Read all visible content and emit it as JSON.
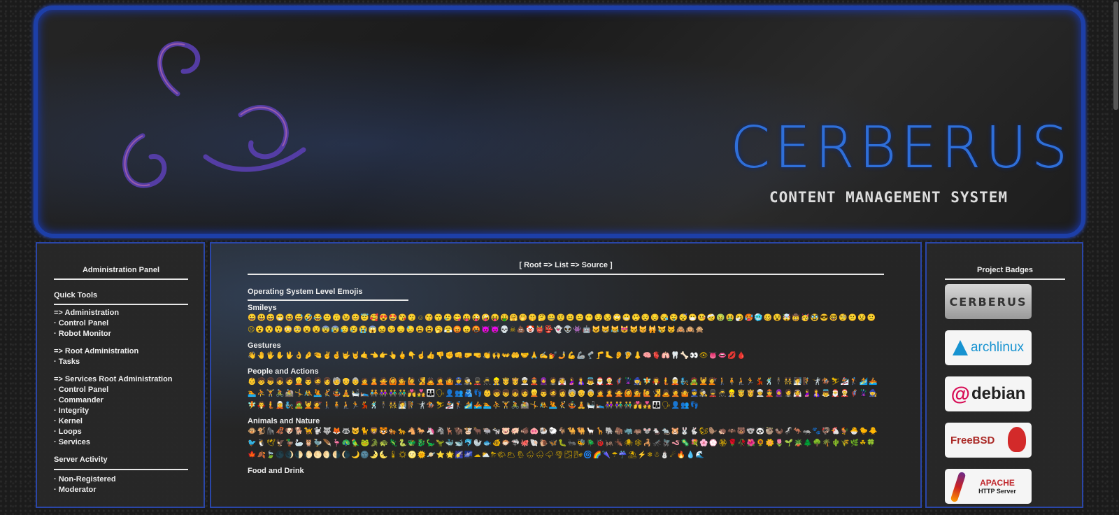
{
  "banner": {
    "title": "CERBERUS",
    "subtitle": "CONTENT MANAGEMENT SYSTEM",
    "colors": {
      "border": "#1d3fa8",
      "title": "#2f6fd8"
    }
  },
  "left_panel": {
    "title": "Administration Panel",
    "quick_tools": "Quick Tools",
    "groups": [
      {
        "header": "=> Administration",
        "items": [
          "· Control Panel",
          "· Robot Monitor"
        ]
      },
      {
        "header": "=> Root Administration",
        "items": [
          "· Tasks"
        ]
      },
      {
        "header": "=> Services Root Administration",
        "items": [
          "· Control Panel",
          "· Commander",
          "· Integrity",
          "· Kernel",
          "· Loops",
          "· Services"
        ]
      }
    ],
    "server_activity": "Server Activity",
    "activity_items": [
      "· Non-Registered",
      "· Moderator"
    ]
  },
  "main": {
    "breadcrumb": {
      "open": "[",
      "items": [
        "Root",
        "List",
        "Source"
      ],
      "sep": "=>",
      "close": "]"
    },
    "section_title": "Operating System Level Emojis",
    "categories": [
      {
        "name": "Smileys",
        "emojis": "😀😃😄😁😆😅🤣😂🙂🙃😉😊😇🥰😍🤩😘😗☺😚😙🥲😋😛😜🤪😝🤑🤗🤭🤫🤔🤐🤨😐😑😶😏😒🙄😬🤥😌😔😪🤤😴😷🤒🤕🤢🤮🤧🥵🥶🥴😵🤯🤠🥳🥸😎🤓🧐😕😟🙁☹😮😯😲😳🥺😦😧😨😰😥😢😭😱😖😣😞😓😩😫🥱😤😡😠🤬😈👿💀☠💩🤡👹👺👻👽👾🤖😺😸😹😻😼😽🙀😿😾🙈🙉🙊"
      },
      {
        "name": "Gestures",
        "emojis": "👋🤚🖐✋🖖👌🤌🤏✌🤞🤟🤘🤙👈👉👆🖕👇☝👍👎✊👊🤛🤜👏🙌👐🤲🤝🙏✍💅🤳💪🦾🦿🦵🦶👂🦻👃🧠🫀🫁🦷🦴👀👁👅👄💋🩸"
      },
      {
        "name": "People and Actions",
        "emojis": "👶🧒👦👧🧑👱👨🧔👩🧓👴👵🙍🙎🙅🙆💁🙋🧏🙇🤦🤷👮🕵💂🥷👷🤴👸👳👲🧕🤵👰🤰🤱👼🎅🤶🦸🦹🧙🧚🧛🧜🧝🧞🧟💆💇🚶🧍🧎🏃💃🕺🕴👯🧖🧗🤺🏇⛷🏂🏌🏄🚣🏊⛹🏋🚴🚵🤸🤼🤽🤾🤹🧘🛀🛌🧑‍🤝‍🧑👭👫👬💏💑👪🗣👤👥🫂👣👶🧒👦👧🧑👱👨🧔👩🧓👴👵🙍🙎🙅🙆💁🙋🧏🙇🤦🤷👮🕵💂🥷👷🤴👸👳👲🧕🤵👰🤰🤱👼🎅🤶🦸🦹🧙🧚🧛🧜🧝🧞🧟💆💇🚶🧍🧎🏃💃🕺🕴👯🧖🧗🤺🏇⛷🏂🏌🏄🚣🏊⛹🏋🚴🚵🤸🤼🤽🤾🤹🧘🛀🛌👭👫👬💏💑👪🗣👤👥👣"
      },
      {
        "name": "Animals and Nature",
        "emojis": "🐵🐒🦍🦧🐶🐕🦮🐩🐺🦊🦝🐱🐈🦁🐯🐅🐆🐴🐎🦄🦓🦌🦬🐮🐂🐃🐄🐷🐖🐗🐽🐏🐑🐐🐪🐫🦙🦒🐘🦣🦏🦛🐭🐁🐀🐹🐰🐇🐿🦫🦔🦇🐻🐨🐼🦥🦦🦨🦘🦡🐾🦃🐔🐓🐣🐤🐥🐦🐧🕊🦅🦆🦢🦉🦤🪶🦩🦚🦜🐸🐊🐢🦎🐍🐲🐉🦕🦖🐳🐋🐬🦭🐟🐠🐡🦈🐙🐚🐌🦋🐛🐜🐝🪲🐞🦗🪳🕷🕸🦂🦟🪰🪱🦠💐🌸💮🏵🌹🥀🌺🌻🌼🌷🌱🪴🌲🌳🌴🌵🌾🌿☘🍀🍁🍂🍃🌑🌒🌓🌔🌕🌖🌗🌘🌙🌚🌛🌜🌡☀🌝🌞🪐⭐🌟🌠🌌☁⛅⛈🌤🌥🌦🌧🌨🌩🌪🌫🌬🌀🌈🌂☂☔⛱⚡❄☃⛄☄🔥💧🌊"
      }
    ],
    "next_category": "Food and Drink"
  },
  "right_panel": {
    "title": "Project Badges",
    "badges": [
      {
        "name": "cerberus",
        "label": "CERBERUS"
      },
      {
        "name": "archlinux",
        "label": "archlinux"
      },
      {
        "name": "debian",
        "label": "debian"
      },
      {
        "name": "freebsd",
        "label": "FreeBSD"
      },
      {
        "name": "apache",
        "label": "APACHE",
        "sub": "HTTP Server"
      }
    ]
  }
}
